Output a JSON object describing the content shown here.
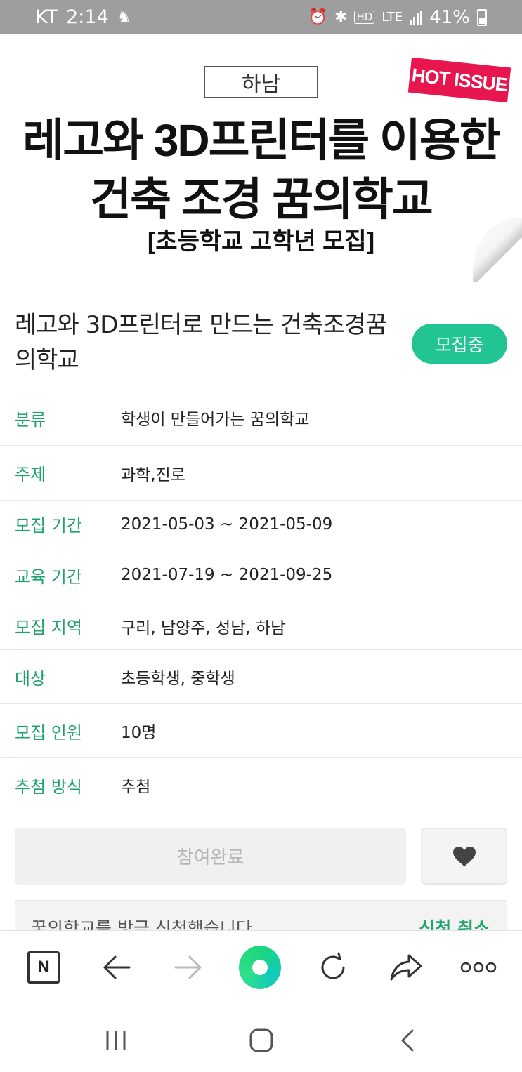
{
  "status_bar": {
    "carrier": "KT",
    "time": "2:14",
    "network": "LTE",
    "hd": "HD",
    "battery": "41%"
  },
  "banner": {
    "tag": "하남",
    "hot_issue": "HOT ISSUE",
    "line1": "레고와 3D프린터를 이용한",
    "line2": "건축 조경 꿈의학교",
    "line3": "[초등학교 고학년 모집]"
  },
  "program": {
    "title": "레고와 3D프린터로 만드는 건축조경꿈의학교",
    "status": "모집중"
  },
  "info_rows": [
    {
      "label": "분류",
      "value": "학생이 만들어가는 꿈의학교"
    },
    {
      "label": "주제",
      "value": "과학,진로"
    },
    {
      "label": "모집 기간",
      "value": "2021-05-03 ~ 2021-05-09"
    },
    {
      "label": "교육 기간",
      "value": "2021-07-19 ~ 2021-09-25"
    },
    {
      "label": "모집 지역",
      "value": "구리, 남양주, 성남, 하남"
    },
    {
      "label": "대상",
      "value": "초등학생, 중학생"
    },
    {
      "label": "모집 인원",
      "value": "10명"
    },
    {
      "label": "추첨 방식",
      "value": "추첨"
    }
  ],
  "actions": {
    "join_label": "참여완료",
    "like_icon": "heart-icon",
    "notice_text": "꿈의학교를 방금 신청했습니다",
    "cancel_label": "신청 취소"
  },
  "colors": {
    "accent_green": "#23c493",
    "label_green": "#20a26d",
    "hot_issue_red": "#e8164f",
    "status_bar_gray": "#9e9e9e"
  }
}
